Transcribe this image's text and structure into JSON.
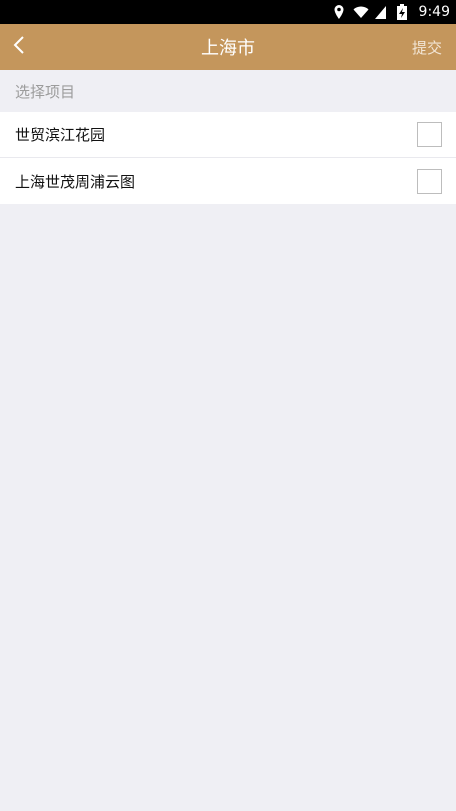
{
  "status_bar": {
    "time": "9:49",
    "icons": [
      "location-icon",
      "wifi-icon",
      "signal-icon",
      "battery-charging-icon"
    ]
  },
  "nav": {
    "title": "上海市",
    "back_icon": "chevron-left-icon",
    "submit_label": "提交"
  },
  "section": {
    "header": "选择项目"
  },
  "projects": [
    {
      "label": "世贸滨江花园",
      "checked": false
    },
    {
      "label": "上海世茂周浦云图",
      "checked": false
    }
  ],
  "colors": {
    "nav_background": "#c4965c",
    "page_background": "#efeff4"
  }
}
